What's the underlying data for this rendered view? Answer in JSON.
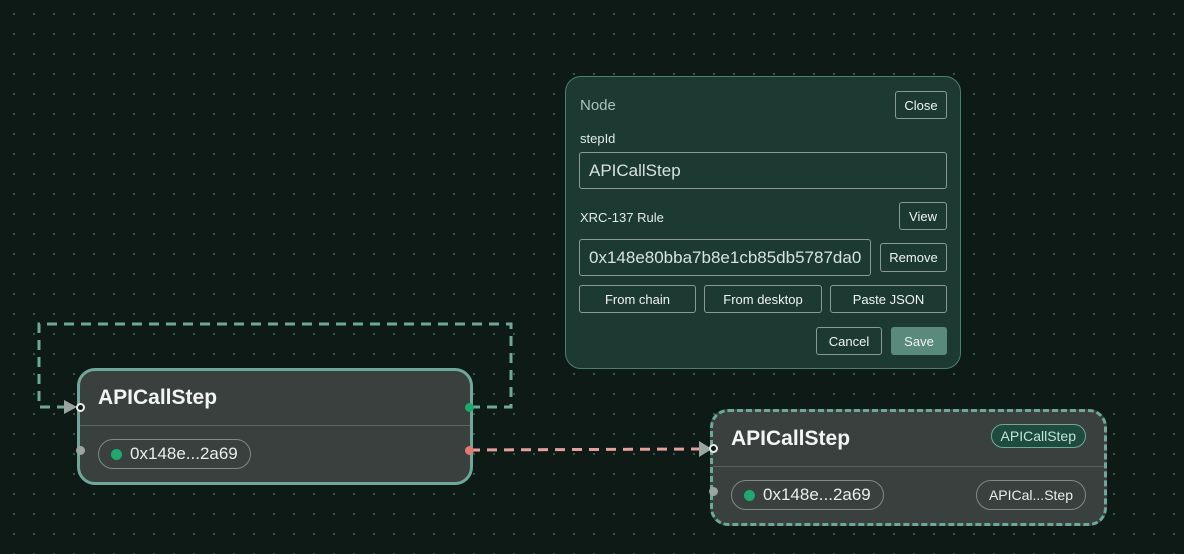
{
  "panel": {
    "title": "Node",
    "close_label": "Close",
    "step_id_label": "stepId",
    "step_id_value": "APICallStep",
    "rule_label": "XRC-137 Rule",
    "view_label": "View",
    "rule_value": "0x148e80bba7b8e1cb85db5787da0",
    "remove_label": "Remove",
    "from_chain_label": "From chain",
    "from_desktop_label": "From desktop",
    "paste_json_label": "Paste JSON",
    "cancel_label": "Cancel",
    "save_label": "Save"
  },
  "nodes": [
    {
      "title": "APICallStep",
      "chip": "0x148e...2a69"
    },
    {
      "title": "APICallStep",
      "badge": "APICallStep",
      "chip": "0x148e...2a69",
      "tag": "APICal...Step"
    }
  ],
  "colors": {
    "canvas": "#0d1a16",
    "node": "#3a403d",
    "accent": "#6fa89a",
    "edge_dashed": "#e6a09a",
    "status_dot": "#1fa86f"
  }
}
